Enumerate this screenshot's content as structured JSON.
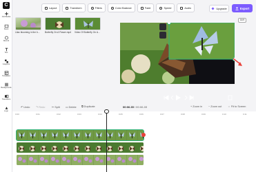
{
  "rail": {
    "items": [
      {
        "label": "Add Media"
      },
      {
        "label": "Stock"
      },
      {
        "label": "Record"
      },
      {
        "label": "Text"
      },
      {
        "label": "Graphics"
      },
      {
        "label": "Templates"
      },
      {
        "label": "Backgrounds"
      },
      {
        "label": "Transitions"
      },
      {
        "label": "Logo"
      }
    ]
  },
  "media": {
    "items": [
      {
        "caption": "Lilac blooming in the b..."
      },
      {
        "caption": "Butterfly On A Flower.mp4"
      },
      {
        "caption": "Video Of Butterfly On A..."
      }
    ]
  },
  "toolbar": {
    "buttons": [
      "Layout",
      "Transform",
      "Filters",
      "Color Balance",
      "Fade",
      "Speed",
      "Audio"
    ],
    "upgrade": "Upgrade",
    "export": "Export"
  },
  "preview": {
    "ratio": "16:9"
  },
  "edit": {
    "undo": "Undo",
    "redo": "Redo",
    "split": "Split",
    "delete": "Delete",
    "duplicate": "Duplicate",
    "time_current": "00:06.35",
    "time_total": "00:06.35",
    "zoom_in": "Zoom in",
    "zoom_out": "Zoom out",
    "fit": "Fit to Screen"
  },
  "ruler": {
    "ticks": [
      "0:00",
      "0:01",
      "0:02",
      "0:03",
      "0:04",
      "0:05",
      "0:06",
      "0:07",
      "0:08",
      "0:09",
      "0:10",
      "0:11"
    ]
  },
  "colors": {
    "accent": "#7c5cff",
    "selection": "#2fb37a",
    "handle": "#e8413a",
    "stage": "#0f0f14"
  }
}
